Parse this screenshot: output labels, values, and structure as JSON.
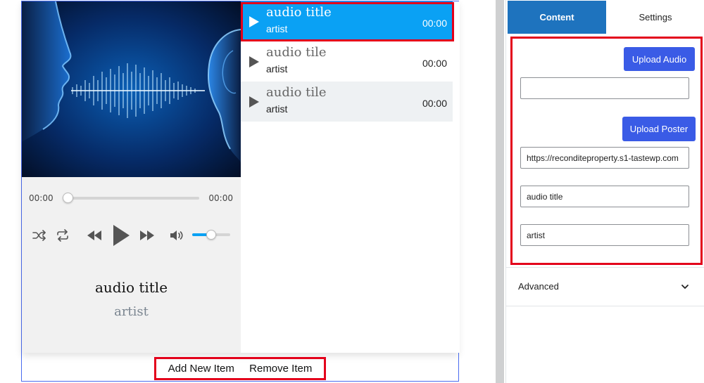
{
  "player": {
    "time_start": "00:00",
    "time_end": "00:00",
    "progress": 0,
    "volume": 0.5,
    "now_playing": {
      "title": "audio title",
      "artist": "artist"
    },
    "actions": {
      "add_label": "Add New Item",
      "remove_label": "Remove Item"
    }
  },
  "playlist": [
    {
      "title": "audio title",
      "artist": "artist",
      "time": "00:00",
      "active": true
    },
    {
      "title": "audio tile",
      "artist": "artist",
      "time": "00:00",
      "active": false
    },
    {
      "title": "audio tile",
      "artist": "artist",
      "time": "00:00",
      "active": false
    }
  ],
  "sidebar": {
    "tabs": {
      "content": "Content",
      "settings": "Settings"
    },
    "upload_audio_label": "Upload Audio",
    "audio_url_value": "",
    "upload_poster_label": "Upload Poster",
    "poster_url_value": "https://reconditeproperty.s1-tastewp.com",
    "title_value": "audio title",
    "artist_value": "artist",
    "advanced_label": "Advanced"
  },
  "colors": {
    "accent": "#0aa1f4",
    "button": "#3a5be6",
    "tab_active": "#1e73be",
    "highlight": "#e3001b"
  }
}
